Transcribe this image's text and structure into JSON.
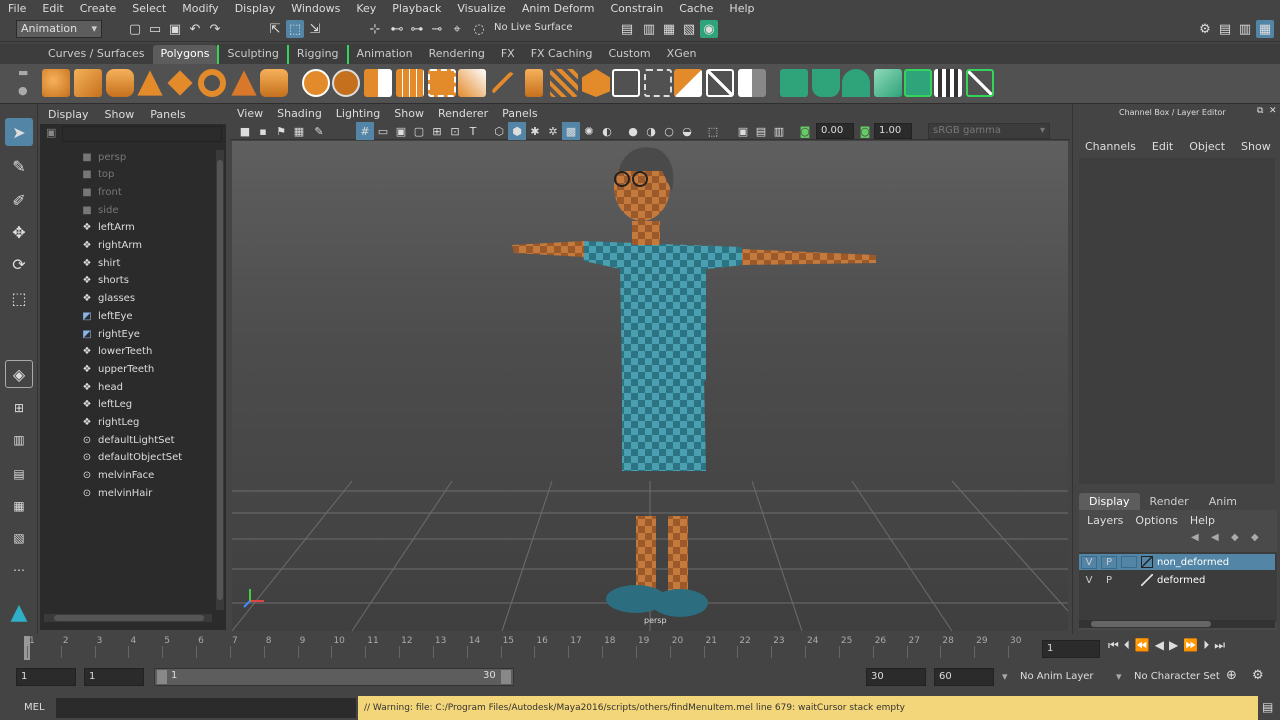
{
  "menubar": {
    "items": [
      "File",
      "Edit",
      "Create",
      "Select",
      "Modify",
      "Display",
      "Windows",
      "Key",
      "Playback",
      "Visualize",
      "Anim Deform",
      "Constrain",
      "Cache",
      "Help"
    ]
  },
  "statusline": {
    "mode_selector": "Animation",
    "live_surface": "No Live Surface"
  },
  "shelf_tabs": {
    "items": [
      "Curves / Surfaces",
      "Polygons",
      "Sculpting",
      "Rigging",
      "Animation",
      "Rendering",
      "FX",
      "FX Caching",
      "Custom",
      "XGen"
    ],
    "active": "Polygons"
  },
  "outliner": {
    "menus": [
      "Display",
      "Show",
      "Panels"
    ],
    "items": [
      {
        "label": "persp",
        "icon": "camera-icon",
        "dim": true
      },
      {
        "label": "top",
        "icon": "camera-icon",
        "dim": true
      },
      {
        "label": "front",
        "icon": "camera-icon",
        "dim": true
      },
      {
        "label": "side",
        "icon": "camera-icon",
        "dim": true
      },
      {
        "label": "leftArm",
        "icon": "mesh-icon",
        "dim": false
      },
      {
        "label": "rightArm",
        "icon": "mesh-icon",
        "dim": false
      },
      {
        "label": "shirt",
        "icon": "mesh-icon",
        "dim": false
      },
      {
        "label": "shorts",
        "icon": "mesh-icon",
        "dim": false
      },
      {
        "label": "glasses",
        "icon": "mesh-icon",
        "dim": false
      },
      {
        "label": "leftEye",
        "icon": "nurbs-icon",
        "dim": false
      },
      {
        "label": "rightEye",
        "icon": "nurbs-icon",
        "dim": false
      },
      {
        "label": "lowerTeeth",
        "icon": "mesh-icon",
        "dim": false
      },
      {
        "label": "upperTeeth",
        "icon": "mesh-icon",
        "dim": false
      },
      {
        "label": "head",
        "icon": "mesh-icon",
        "dim": false
      },
      {
        "label": "leftLeg",
        "icon": "mesh-icon",
        "dim": false
      },
      {
        "label": "rightLeg",
        "icon": "mesh-icon",
        "dim": false
      },
      {
        "label": "defaultLightSet",
        "icon": "set-icon",
        "dim": false
      },
      {
        "label": "defaultObjectSet",
        "icon": "set-icon",
        "dim": false
      },
      {
        "label": "melvinFace",
        "icon": "set-icon",
        "dim": false
      },
      {
        "label": "melvinHair",
        "icon": "set-icon",
        "dim": false
      }
    ]
  },
  "viewport": {
    "menus": [
      "View",
      "Shading",
      "Lighting",
      "Show",
      "Renderer",
      "Panels"
    ],
    "exposure": "0.00",
    "gamma": "1.00",
    "color_space": "sRGB gamma",
    "camera_label": "persp"
  },
  "channel_box": {
    "title": "Channel Box / Layer Editor",
    "menus": [
      "Channels",
      "Edit",
      "Object",
      "Show"
    ],
    "layer_tabs": [
      "Display",
      "Render",
      "Anim"
    ],
    "layer_menus": [
      "Layers",
      "Options",
      "Help"
    ],
    "layers": [
      {
        "v": "V",
        "p": "P",
        "name": "non_deformed",
        "selected": true
      },
      {
        "v": "V",
        "p": "P",
        "name": "deformed",
        "selected": false
      }
    ]
  },
  "timeline": {
    "ticks": [
      "1",
      "2",
      "3",
      "4",
      "5",
      "6",
      "7",
      "8",
      "9",
      "10",
      "11",
      "12",
      "13",
      "14",
      "15",
      "16",
      "17",
      "18",
      "19",
      "20",
      "21",
      "22",
      "23",
      "24",
      "25",
      "26",
      "27",
      "28",
      "29",
      "30"
    ],
    "current_frame": "1"
  },
  "range": {
    "start": "1",
    "playback_start": "1",
    "slider_start": "1",
    "slider_end": "30",
    "playback_end": "30",
    "end": "60",
    "anim_layer": "No Anim Layer",
    "character_set": "No Character Set"
  },
  "cmdline": {
    "label": "MEL",
    "message": "// Warning: file: C:/Program Files/Autodesk/Maya2016/scripts/others/findMenuItem.mel line 679: waitCursor stack empty"
  },
  "colors": {
    "accent": "#5285a6",
    "warning_bg": "#f3d67a",
    "shelf_orange": "#e38a2b",
    "shelf_green": "#2fa37a"
  }
}
